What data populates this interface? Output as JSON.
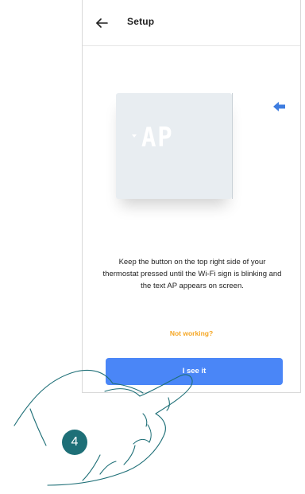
{
  "header": {
    "title": "Setup",
    "back_icon": "arrow-left-icon"
  },
  "device": {
    "display_text": "AP",
    "button_indicator_icon": "arrow-left-icon",
    "colors": {
      "panel": "#e8edf1",
      "indicator": "#3e7de0"
    }
  },
  "body": {
    "instruction": "Keep the button on the top right side of your thermostat pressed until the Wi-Fi sign is blinking and the text AP appears on screen.",
    "help_link": "Not working?"
  },
  "actions": {
    "primary_label": "I see it"
  },
  "annotation": {
    "step_number": "4"
  },
  "colors": {
    "accent": "#4a86f7",
    "link": "#f5a623",
    "badge": "#1e6f77"
  }
}
